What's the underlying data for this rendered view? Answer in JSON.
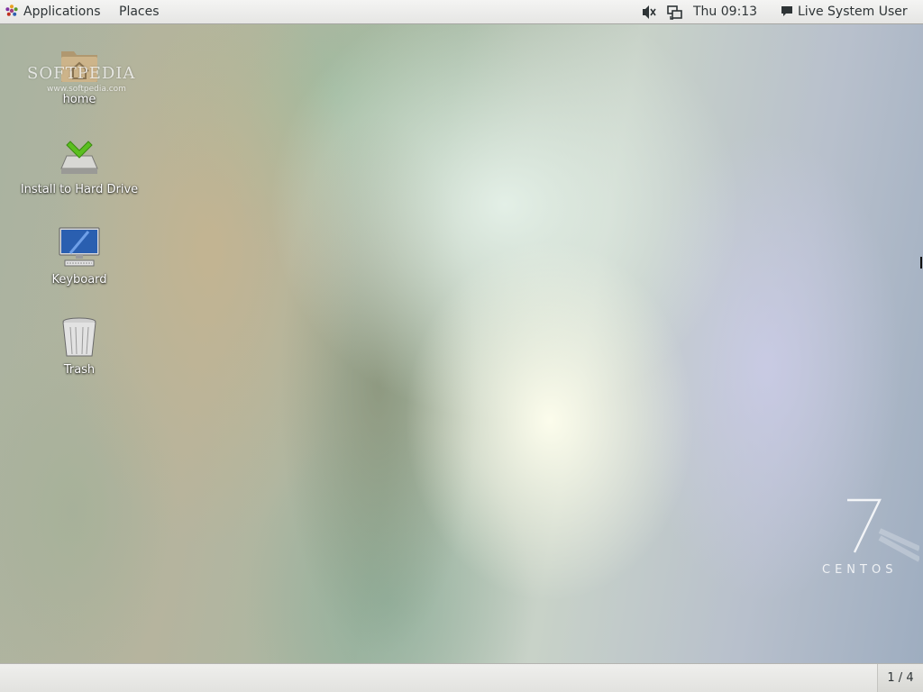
{
  "top_panel": {
    "applications_label": "Applications",
    "places_label": "Places",
    "clock": "Thu 09:13",
    "user_label": "Live System User"
  },
  "desktop": {
    "icons": [
      {
        "label": "home",
        "icon": "home-folder-icon"
      },
      {
        "label": "Install to Hard Drive",
        "icon": "install-drive-icon"
      },
      {
        "label": "Keyboard",
        "icon": "computer-monitor-icon"
      },
      {
        "label": "Trash",
        "icon": "trash-icon"
      }
    ],
    "watermark": {
      "name": "SOFTPEDIA",
      "url": "www.softpedia.com"
    },
    "logo": {
      "number": "7",
      "brand": "CENTOS"
    }
  },
  "bottom_panel": {
    "workspace": "1 / 4"
  },
  "colors": {
    "panel_bg": "#e6e6e4",
    "panel_text": "#2e3436",
    "label_text": "#ffffff",
    "install_check": "#5bbf1f",
    "monitor_screen": "#2a5fb0"
  }
}
